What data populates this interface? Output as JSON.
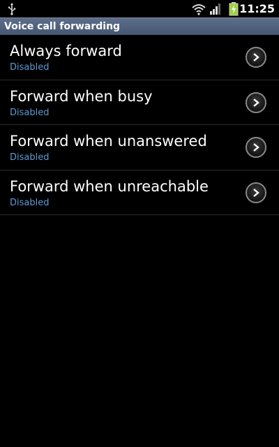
{
  "status_bar": {
    "time": "11:25",
    "icons": [
      "usb-icon",
      "wifi-icon",
      "signal-icon",
      "battery-charging-icon"
    ]
  },
  "title_bar": {
    "title": "Voice call forwarding"
  },
  "list": {
    "items": [
      {
        "title": "Always forward",
        "summary": "Disabled"
      },
      {
        "title": "Forward when busy",
        "summary": "Disabled"
      },
      {
        "title": "Forward when unanswered",
        "summary": "Disabled"
      },
      {
        "title": "Forward when unreachable",
        "summary": "Disabled"
      }
    ]
  },
  "colors": {
    "summary_text": "#5d9ad4",
    "title_bar": "#52637f",
    "battery": "#9fd13c"
  }
}
